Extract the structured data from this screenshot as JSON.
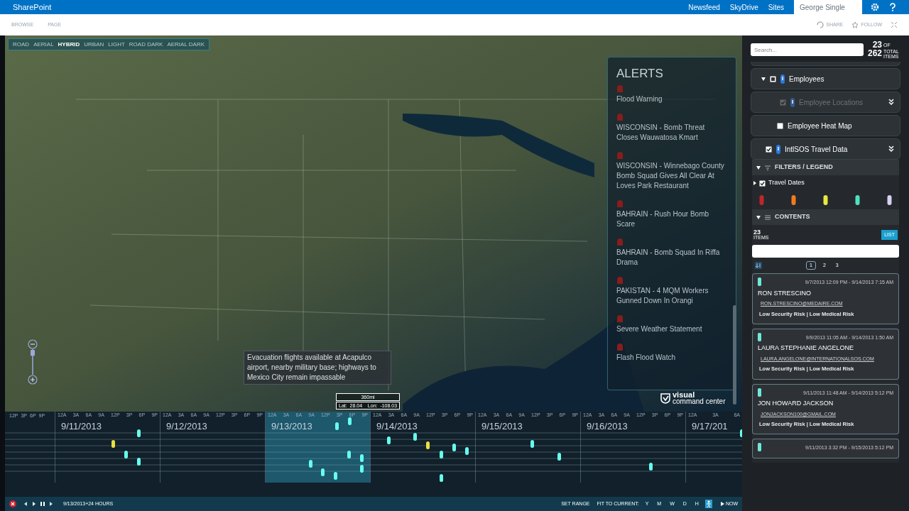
{
  "suite_bar": {
    "brand": "SharePoint",
    "links": [
      "Newsfeed",
      "SkyDrive",
      "Sites"
    ],
    "user": "George Single"
  },
  "ribbon": {
    "tabs": [
      "BROWSE",
      "PAGE"
    ],
    "actions": [
      "SHARE",
      "FOLLOW"
    ]
  },
  "map": {
    "styles": [
      {
        "label": "ROAD",
        "selected": false
      },
      {
        "label": "AERIAL",
        "selected": false
      },
      {
        "label": "HYBRID",
        "selected": true
      },
      {
        "label": "URBAN",
        "selected": false
      },
      {
        "label": "LIGHT",
        "selected": false
      },
      {
        "label": "ROAD DARK",
        "selected": false
      },
      {
        "label": "AERIAL DARK",
        "selected": false
      }
    ],
    "tooltip": "Evacuation flights available at Acapulco airport, nearby military base; highways to Mexico City remain impassable",
    "zoom": {
      "level": 0.7
    },
    "scale": "360mi",
    "coords": "Lat:  28.04    Lon:  -108.03",
    "logo": [
      "visual",
      "command center"
    ]
  },
  "alerts": {
    "title": "ALERTS",
    "items": [
      {
        "title": "Flood Warning"
      },
      {
        "title": "WISCONSIN - Bomb Threat Closes Wauwatosa Kmart"
      },
      {
        "title": "WISCONSIN - Winnebago County Bomb Squad Gives All Clear At Loves Park Restaurant"
      },
      {
        "title": "BAHRAIN - Rush Hour Bomb Scare"
      },
      {
        "title": "BAHRAIN - Bomb Squad In Riffa Drama"
      },
      {
        "title": "PAKISTAN - 4 MQM Workers Gunned Down In Orangi"
      },
      {
        "title": "Severe Weather Statement"
      },
      {
        "title": "Flash Flood Watch"
      }
    ]
  },
  "timeline": {
    "lead_ticks": [
      "12P",
      "3P",
      "6P",
      "9P"
    ],
    "days": [
      {
        "date": "9/11/2013",
        "ticks": [
          "12A",
          "3A",
          "6A",
          "9A",
          "12P",
          "3P",
          "6P",
          "9P"
        ],
        "selected": false
      },
      {
        "date": "9/12/2013",
        "ticks": [
          "12A",
          "3A",
          "6A",
          "9A",
          "12P",
          "3P",
          "6P",
          "9P"
        ],
        "selected": false
      },
      {
        "date": "9/13/2013",
        "ticks": [
          "12A",
          "3A",
          "6A",
          "9A",
          "12P",
          "3P",
          "6P",
          "9P"
        ],
        "selected": true
      },
      {
        "date": "9/14/2013",
        "ticks": [
          "12A",
          "3A",
          "6A",
          "9A",
          "12P",
          "3P",
          "6P",
          "9P"
        ],
        "selected": false
      },
      {
        "date": "9/15/2013",
        "ticks": [
          "12A",
          "3A",
          "6A",
          "9A",
          "12P",
          "3P",
          "6P",
          "9P"
        ],
        "selected": false
      },
      {
        "date": "9/16/2013",
        "ticks": [
          "12A",
          "3A",
          "6A",
          "9A",
          "12P",
          "3P",
          "6P",
          "9P"
        ],
        "selected": false
      },
      {
        "date": "9/17/201",
        "ticks": [
          "12A",
          "3A",
          "6A"
        ],
        "selected": false
      }
    ],
    "range": "9/13/2013+24 HOURS",
    "set_range": "SET RANGE",
    "fit_label": "FIT TO CURRENT:",
    "scales": [
      {
        "label": "Y",
        "selected": false
      },
      {
        "label": "M",
        "selected": false
      },
      {
        "label": "W",
        "selected": false
      },
      {
        "label": "D",
        "selected": false
      },
      {
        "label": "H",
        "selected": false
      }
    ],
    "now": "NOW"
  },
  "panel": {
    "search_placeholder": "Search...",
    "count": "23",
    "of": "OF",
    "total": "262",
    "total_label": "TOTAL ITEMS",
    "layers": [
      {
        "kind": "group",
        "label": "Employees",
        "checked": false,
        "indeterminate": true,
        "disabled": false,
        "pin": true,
        "menu": false
      },
      {
        "kind": "sublayer",
        "label": "Employee Locations",
        "checked": true,
        "indeterminate": false,
        "disabled": true,
        "pin": true,
        "menu": true
      },
      {
        "kind": "layer",
        "label": "Employee Heat Map",
        "checked": false,
        "indeterminate": false,
        "disabled": false,
        "pin": false,
        "menu": false
      },
      {
        "kind": "layer",
        "label": "IntlSOS Travel Data",
        "checked": true,
        "indeterminate": false,
        "disabled": false,
        "pin": true,
        "menu": true
      }
    ],
    "filters_title": "FILTERS / LEGEND",
    "travel_dates": {
      "label": "Travel Dates",
      "checked": true
    },
    "legend": [
      {
        "color": "#c0262a"
      },
      {
        "color": "#f07b20"
      },
      {
        "color": "#e8e840"
      },
      {
        "color": "#50e0c0"
      },
      {
        "color": "#d8d0f0"
      }
    ],
    "contents_title": "CONTENTS",
    "items_count": "23",
    "items_label": "ITEMS",
    "list_button": "LIST",
    "pages": [
      {
        "label": "1",
        "selected": true
      },
      {
        "label": "2",
        "selected": false
      },
      {
        "label": "3",
        "selected": false
      }
    ],
    "cards": [
      {
        "dates": "9/7/2013 12:09 PM - 9/14/2013 7:15 AM",
        "name": "RON STRESCINO",
        "email": "RON.STRESCINO@MEDAIRE.COM",
        "risk": "Low Security Risk | Low Medical Risk"
      },
      {
        "dates": "9/9/2013 11:05 AM - 9/14/2013 1:50 AM",
        "name": "LAURA STEPHANIE ANGELONE",
        "email": "LAURA.ANGELONE@INTERNATIONALSOS.COM",
        "risk": "Low Security Risk | Low Medical Risk"
      },
      {
        "dates": "9/11/2013 11:48 AM - 9/14/2013 5:12 PM",
        "name": "JON HOWARD JACKSON",
        "email": "JONJACKSON100@GMAIL.COM",
        "risk": "Low Security Risk | Low Medical Risk"
      },
      {
        "dates": "9/11/2013 3:32 PM - 9/15/2013 5:12 PM"
      }
    ]
  }
}
